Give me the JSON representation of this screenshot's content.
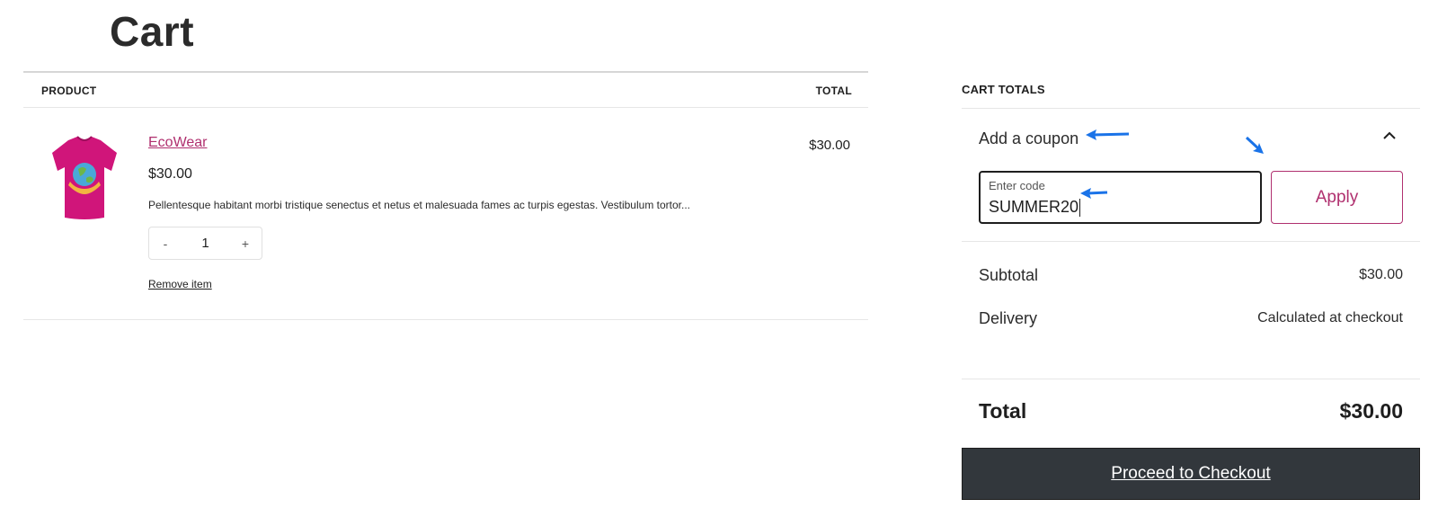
{
  "page": {
    "title": "Cart"
  },
  "cart_table": {
    "header_product": "PRODUCT",
    "header_total": "TOTAL",
    "items": [
      {
        "name": "EcoWear",
        "price": "$30.00",
        "description": "Pellentesque habitant morbi tristique senectus et netus et malesuada fames ac turpis egestas. Vestibulum tortor...",
        "quantity": "1",
        "decrement_label": "-",
        "increment_label": "+",
        "remove_label": "Remove item",
        "line_total": "$30.00",
        "thumbnail_icon": "tshirt-icon"
      }
    ]
  },
  "totals": {
    "heading": "CART TOTALS",
    "coupon_toggle": "Add a coupon",
    "coupon_label": "Enter code",
    "coupon_value": "SUMMER20",
    "apply_label": "Apply",
    "subtotal_label": "Subtotal",
    "subtotal_value": "$30.00",
    "delivery_label": "Delivery",
    "delivery_value": "Calculated at checkout",
    "total_label": "Total",
    "total_value": "$30.00",
    "checkout_label": "Proceed to Checkout"
  },
  "colors": {
    "accent": "#b0306f",
    "button_dark": "#32373c",
    "annotation_arrow": "#1a73e8",
    "tshirt": "#d0157a"
  }
}
